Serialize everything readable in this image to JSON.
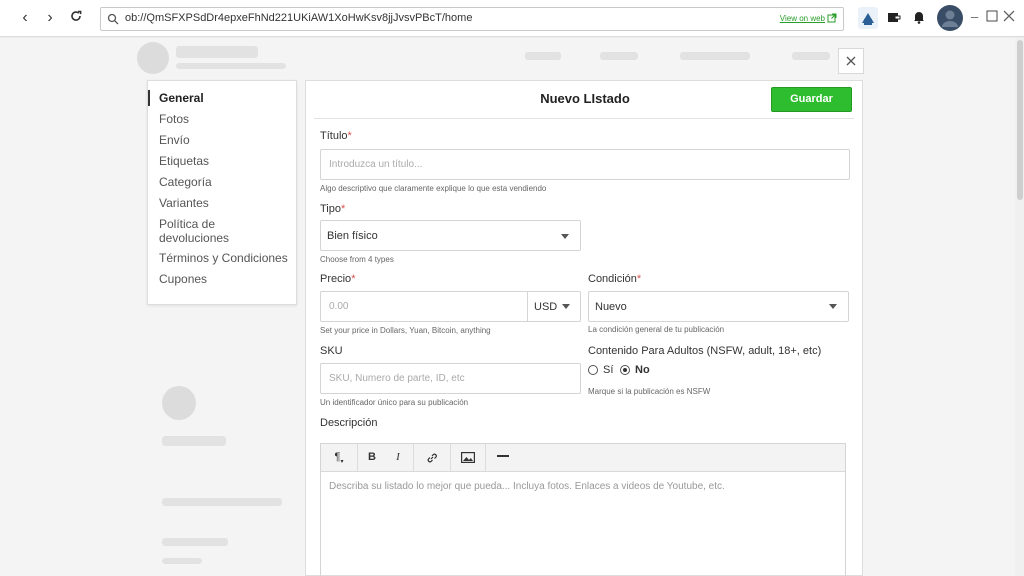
{
  "browser": {
    "url": "ob://QmSFXPSdDr4epxeFhNd221UKiAW1XoHwKsv8jjJvsvPBcT/home",
    "view_on_web": "View on web"
  },
  "sidebar": {
    "items": [
      {
        "label": "General"
      },
      {
        "label": "Fotos"
      },
      {
        "label": "Envío"
      },
      {
        "label": "Etiquetas"
      },
      {
        "label": "Categoría"
      },
      {
        "label": "Variantes"
      },
      {
        "label": "Política de devoluciones"
      },
      {
        "label": "Términos y Condiciones"
      },
      {
        "label": "Cupones"
      }
    ]
  },
  "header": {
    "title": "Nuevo LIstado",
    "save_label": "Guardar"
  },
  "form": {
    "title": {
      "label": "Título",
      "required": "*",
      "placeholder": "Introduzca un título...",
      "help": "Algo descriptivo que claramente explique lo que esta vendiendo"
    },
    "type": {
      "label": "Tipo",
      "required": "*",
      "value": "Bien físico",
      "help": "Choose from 4 types"
    },
    "price": {
      "label": "Precio",
      "required": "*",
      "placeholder": "0.00",
      "currency": "USD",
      "help": "Set your price in Dollars, Yuan, Bitcoin, anything"
    },
    "condition": {
      "label": "Condición",
      "required": "*",
      "value": "Nuevo",
      "help": "La condición general de tu publicación"
    },
    "sku": {
      "label": "SKU",
      "placeholder": "SKU, Numero de parte, ID, etc",
      "help": "Un identificador único para su publicación"
    },
    "adult": {
      "label": "Contenido Para Adultos (NSFW, adult, 18+, etc)",
      "option_yes": "Sí",
      "option_no": "No",
      "selected": "No",
      "help": "Marque si la publicación es NSFW"
    },
    "description": {
      "label": "Descripción",
      "placeholder": "Describa su listado lo mejor que pueda... Incluya fotos. Enlaces a videos de Youtube, etc.",
      "toolbar": {
        "paragraph": "¶",
        "bold": "B",
        "italic": "I",
        "link": "🔗",
        "image": "🖼",
        "rule": "—"
      }
    }
  },
  "colors": {
    "accent_green": "#2ebd2e",
    "required_red": "#d9534f"
  }
}
